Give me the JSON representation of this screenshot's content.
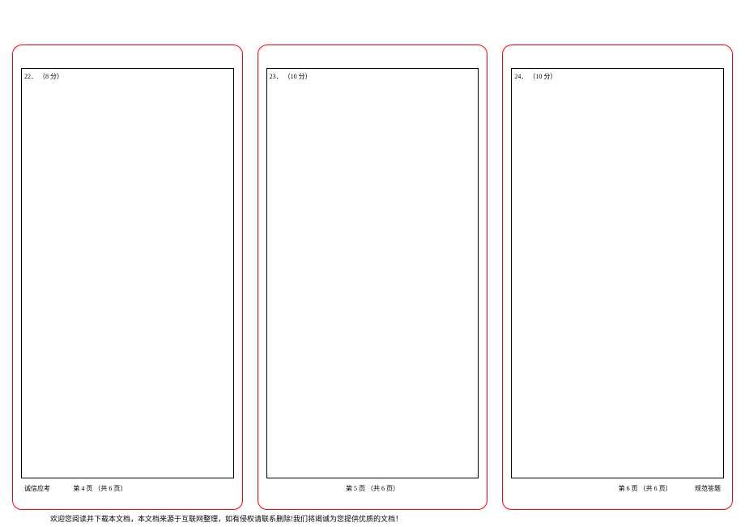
{
  "panels": [
    {
      "question_number": "22．",
      "question_score": "（8 分）",
      "footer_left": "诚信应考",
      "footer_center": "第 4 页 （共 6 页）",
      "footer_right": ""
    },
    {
      "question_number": "23．",
      "question_score": "（10 分）",
      "footer_left": "",
      "footer_center": "第 5 页 （共 6 页）",
      "footer_right": ""
    },
    {
      "question_number": "24．",
      "question_score": "（10 分）",
      "footer_left": "",
      "footer_center": "第 6 页 （共 6 页）",
      "footer_right": "规范答题"
    }
  ],
  "disclaimer": "欢迎您阅读并下载本文档，本文档来源于互联网整理，如有侵权请联系删除!我们将竭诚为您提供优质的文档！"
}
